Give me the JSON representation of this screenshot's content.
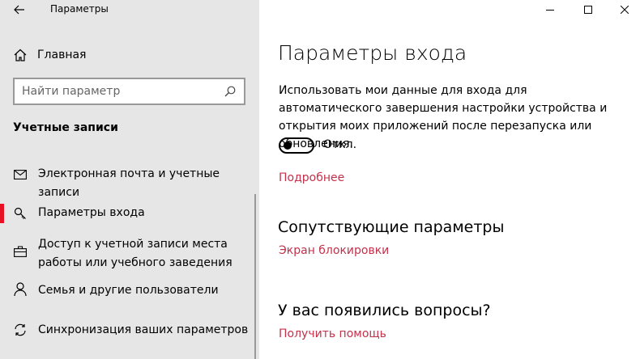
{
  "window": {
    "title": "Параметры",
    "controls": [
      "minimize-icon",
      "maximize-icon",
      "close-icon"
    ]
  },
  "sidebar": {
    "home_label": "Главная",
    "search_placeholder": "Найти параметр",
    "section_title": "Учетные записи",
    "items": [
      {
        "label": "Электронная почта и учетные записи",
        "icon": "mail-icon",
        "selected": false
      },
      {
        "label": "Параметры входа",
        "icon": "key-icon",
        "selected": true
      },
      {
        "label": "Доступ к учетной записи места работы или учебного заведения",
        "icon": "briefcase-icon",
        "selected": false
      },
      {
        "label": "Семья и другие пользователи",
        "icon": "person-icon",
        "selected": false
      },
      {
        "label": "Синхронизация ваших параметров",
        "icon": "sync-icon",
        "selected": false
      }
    ]
  },
  "main": {
    "title": "Параметры входа",
    "description": "Использовать мои данные для входа для автоматического завершения настройки устройства и открытия моих приложений после перезапуска или обновления.",
    "toggle_state": "Откл.",
    "toggle_on": false,
    "more_link": "Подробнее",
    "related_title": "Сопутствующие параметры",
    "related_link": "Экран блокировки",
    "questions_title": "У вас появились вопросы?",
    "help_link": "Получить помощь"
  },
  "colors": {
    "sidebar_bg": "#e6e6e6",
    "accent_selected": "#e81123",
    "link": "#c4314b"
  }
}
